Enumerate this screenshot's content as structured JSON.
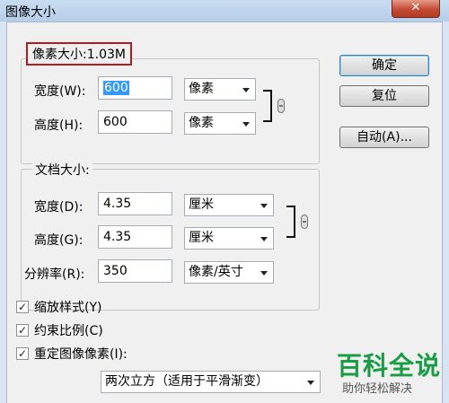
{
  "window": {
    "title": "图像大小",
    "close_glyph": "✕"
  },
  "pixel_dimensions": {
    "label": "像素大小:1.03M",
    "width": {
      "label": "宽度(W):",
      "value": "600",
      "unit": "像素"
    },
    "height": {
      "label": "高度(H):",
      "value": "600",
      "unit": "像素"
    }
  },
  "document_size": {
    "label": "文档大小:",
    "width": {
      "label": "宽度(D):",
      "value": "4.35",
      "unit": "厘米"
    },
    "height": {
      "label": "高度(G):",
      "value": "4.35",
      "unit": "厘米"
    },
    "resolution": {
      "label": "分辨率(R):",
      "value": "350",
      "unit": "像素/英寸"
    }
  },
  "buttons": {
    "ok": "确定",
    "reset": "复位",
    "auto": "自动(A)..."
  },
  "checkboxes": {
    "scale_styles": {
      "label": "缩放样式(Y)",
      "checked": true
    },
    "constrain": {
      "label": "约束比例(C)",
      "checked": true
    },
    "resample": {
      "label": "重定图像像素(I):",
      "checked": true
    }
  },
  "resample_method": "两次立方（适用于平滑渐变）",
  "check_glyph": "✓",
  "watermark": {
    "main": "百科全说",
    "sub": "助你轻松解决"
  }
}
